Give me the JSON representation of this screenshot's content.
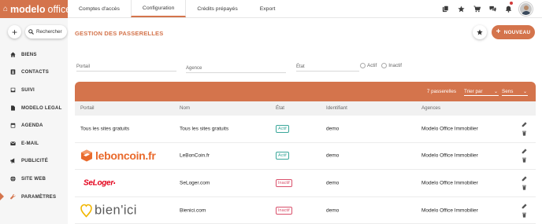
{
  "app": {
    "logo_text_bold": "modelo",
    "logo_text_rest": "office"
  },
  "topnav": {
    "tabs": [
      {
        "label": "Comptes d'accès",
        "active": false
      },
      {
        "label": "Configuration",
        "active": true
      },
      {
        "label": "Crédits prépayés",
        "active": false
      },
      {
        "label": "Export",
        "active": false
      }
    ],
    "icons": [
      "documents-icon",
      "star-icon",
      "cart-icon",
      "chat-icon",
      "bell-icon"
    ]
  },
  "sidebar": {
    "search_label": "Rechercher",
    "items": [
      {
        "label": "BIENS",
        "icon": "home-icon"
      },
      {
        "label": "CONTACTS",
        "icon": "contact-icon"
      },
      {
        "label": "SUIVI",
        "icon": "tray-icon"
      },
      {
        "label": "MODELO LEGAL",
        "icon": "document-icon"
      },
      {
        "label": "AGENDA",
        "icon": "calendar-icon"
      },
      {
        "label": "E-MAIL",
        "icon": "mail-icon"
      },
      {
        "label": "PUBLICITÉ",
        "icon": "megaphone-icon"
      },
      {
        "label": "SITE WEB",
        "icon": "globe-icon"
      },
      {
        "label": "PARAMÈTRES",
        "icon": "wrench-icon",
        "active": true
      }
    ]
  },
  "main": {
    "title": "GESTION DES PASSERELLES",
    "new_button": "NOUVEAU",
    "filters": {
      "portail_label": "Portail",
      "agence_label": "Agence",
      "etat_label": "État",
      "radio_actif": "Actif",
      "radio_inactif": "Inactif"
    },
    "table_bar": {
      "count": "7 passerelles",
      "sort_label": "Trier par",
      "order_label": "Sens"
    },
    "columns": [
      "Portail",
      "Nom",
      "État",
      "Identifiant",
      "Agences"
    ],
    "rows": [
      {
        "portail": "Tous les sites gratuits",
        "logo": "",
        "nom": "Tous les sites gratuits",
        "etat": "Actif",
        "identifiant": "demo",
        "agence": "Modelo Office Immobilier"
      },
      {
        "portail": "",
        "logo": "leboncoin",
        "logo_text": "leboncoin.fr",
        "nom": "LeBonCoin.fr",
        "etat": "Actif",
        "identifiant": "demo",
        "agence": "Modelo Office Immobilier"
      },
      {
        "portail": "",
        "logo": "seloger",
        "logo_text": "SeLoger",
        "nom": "SeLoger.com",
        "etat": "Inactif",
        "identifiant": "demo",
        "agence": "Modelo Office Immobilier"
      },
      {
        "portail": "",
        "logo": "bienici",
        "logo_text": "bien'ici",
        "nom": "Bienici.com",
        "etat": "Inactif",
        "identifiant": "demo",
        "agence": "Modelo Office Immobilier"
      }
    ]
  },
  "colors": {
    "accent": "#d4744c",
    "actif": "#3aa79a",
    "inactif": "#d9506b"
  }
}
